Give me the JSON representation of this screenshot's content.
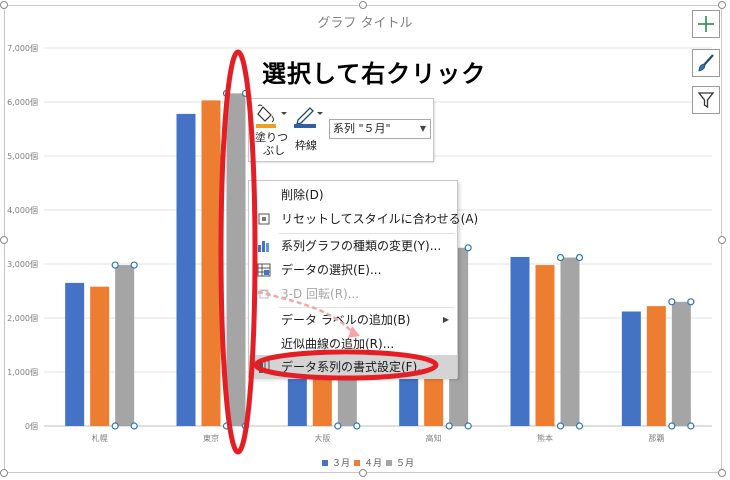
{
  "annotation": {
    "text": "選択して右クリック"
  },
  "mini_toolbar": {
    "fill_label": "塗りつぶし",
    "fill_label_line1": "塗りつ",
    "fill_label_line2": "ぶし",
    "outline_label": "枠線",
    "series_select_value": "系列 \"５月\""
  },
  "context_menu": {
    "items": [
      {
        "label": "削除(D)",
        "icon": "delete-icon",
        "disabled": false
      },
      {
        "label": "リセットしてスタイルに合わせる(A)",
        "icon": "reset-style-icon",
        "disabled": false
      },
      {
        "label": "系列グラフの種類の変更(Y)...",
        "icon": "chart-type-icon",
        "disabled": false
      },
      {
        "label": "データの選択(E)...",
        "icon": "select-data-icon",
        "disabled": false
      },
      {
        "label": "3-D 回転(R)...",
        "icon": "rotate-3d-icon",
        "disabled": true
      },
      {
        "label": "データ ラベルの追加(B)",
        "icon": "",
        "disabled": false,
        "submenu": true
      },
      {
        "label": "近似曲線の追加(R)...",
        "icon": "",
        "disabled": false
      },
      {
        "label": "データ系列の書式設定(F)...",
        "icon": "format-series-icon",
        "disabled": false,
        "highlighted": true
      }
    ]
  },
  "side_buttons": [
    "chart-elements-plus-icon",
    "chart-styles-brush-icon",
    "chart-filter-icon"
  ],
  "colors": {
    "series_3": "#4472c4",
    "series_4": "#ed7d31",
    "series_5": "#a5a5a5",
    "annotation_red": "#e31e24",
    "arrow_pink": "#f4a6a6",
    "selection_handle": "#2e75b6"
  },
  "chart_data": {
    "type": "bar",
    "title": "グラフ タイトル",
    "categories": [
      "札幌",
      "東京",
      "大阪",
      "高知",
      "熊本",
      "那覇"
    ],
    "series": [
      {
        "name": "３月",
        "values": [
          2650,
          5780,
          1850,
          1850,
          3130,
          2120
        ]
      },
      {
        "name": "４月",
        "values": [
          2580,
          6030,
          1850,
          1850,
          2980,
          2220
        ]
      },
      {
        "name": "５月",
        "values": [
          2980,
          6160,
          4150,
          3300,
          3120,
          2300
        ]
      }
    ],
    "ylim": [
      0,
      7000
    ],
    "yticks": [
      "0個",
      "1,000個",
      "2,000個",
      "3,000個",
      "4,000個",
      "5,000個",
      "6,000個",
      "7,000個"
    ],
    "grid": true,
    "legend_position": "bottom",
    "selected_series": "５月"
  }
}
